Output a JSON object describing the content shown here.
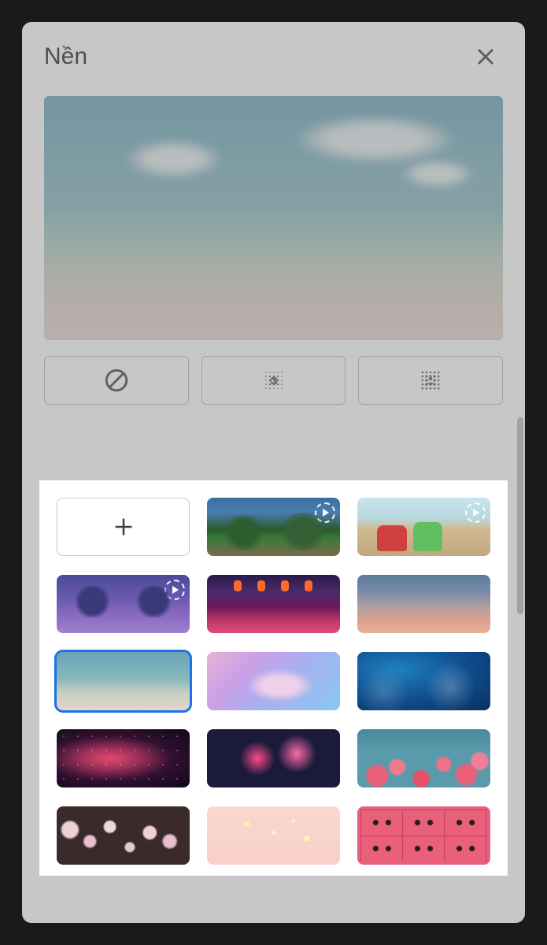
{
  "header": {
    "title": "Nền"
  },
  "effects": {
    "none": "none-icon",
    "blur_light": "blur-light-icon",
    "blur_strong": "blur-strong-icon"
  },
  "backgrounds": {
    "selected_index": 6,
    "items": [
      {
        "name": "add",
        "type": "add",
        "animated": false
      },
      {
        "name": "forest",
        "type": "image",
        "animated": true
      },
      {
        "name": "classroom",
        "type": "image",
        "animated": true
      },
      {
        "name": "arches",
        "type": "image",
        "animated": true
      },
      {
        "name": "lanterns",
        "type": "image",
        "animated": false
      },
      {
        "name": "sunset",
        "type": "image",
        "animated": false
      },
      {
        "name": "beach",
        "type": "image",
        "animated": false
      },
      {
        "name": "clouds",
        "type": "image",
        "animated": false
      },
      {
        "name": "water",
        "type": "image",
        "animated": false
      },
      {
        "name": "nebula",
        "type": "image",
        "animated": false
      },
      {
        "name": "fireworks",
        "type": "image",
        "animated": false
      },
      {
        "name": "flowers",
        "type": "image",
        "animated": false
      },
      {
        "name": "blossom",
        "type": "image",
        "animated": false
      },
      {
        "name": "pink",
        "type": "image",
        "animated": false
      },
      {
        "name": "cassette",
        "type": "image",
        "animated": false
      }
    ]
  },
  "colors": {
    "highlight": "#e30613",
    "selection": "#1a73e8"
  }
}
